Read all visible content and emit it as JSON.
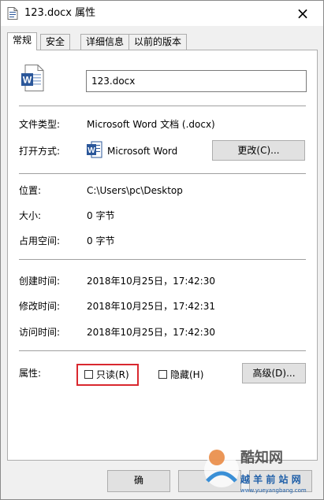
{
  "window": {
    "title": "123.docx 属性",
    "close_glyph": "×"
  },
  "tabs": [
    "常规",
    "安全",
    "详细信息",
    "以前的版本"
  ],
  "file": {
    "name": "123.docx"
  },
  "info": {
    "type_label": "文件类型:",
    "type_value": "Microsoft Word 文档 (.docx)",
    "opens_label": "打开方式:",
    "opens_value": "Microsoft Word",
    "change_button": "更改(C)...",
    "location_label": "位置:",
    "location_value": "C:\\Users\\pc\\Desktop",
    "size_label": "大小:",
    "size_value": "0 字节",
    "disk_label": "占用空间:",
    "disk_value": "0 字节",
    "created_label": "创建时间:",
    "created_value": "2018年10月25日，17:42:30",
    "modified_label": "修改时间:",
    "modified_value": "2018年10月25日，17:42:31",
    "accessed_label": "访问时间:",
    "accessed_value": "2018年10月25日，17:42:30",
    "attributes_label": "属性:",
    "readonly_label": "只读(R)",
    "readonly_checked": false,
    "hidden_label": "隐藏(H)",
    "hidden_checked": false,
    "advanced_button": "高级(D)..."
  },
  "footer": {
    "ok_partial": "确"
  },
  "watermark": {
    "brand": "酷知网",
    "site_name": "越 羊 前 站 网",
    "site_url": "www.yueyangbang.com"
  },
  "colors": {
    "highlight": "#d9282f",
    "word_blue": "#2b579a"
  }
}
